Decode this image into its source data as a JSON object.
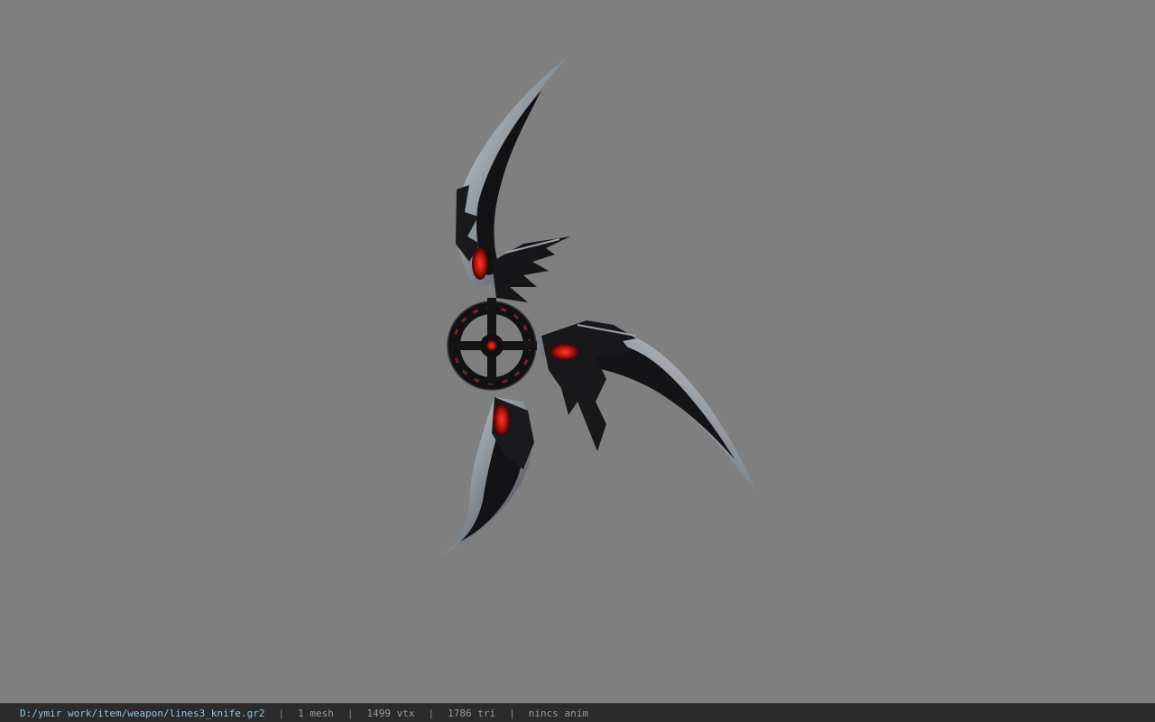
{
  "viewport": {
    "background": "#7f7f7f",
    "model_icon": "throwing-blade-model"
  },
  "status": {
    "path": "D:/ymir work/item/weapon/lines3_knife.gr2",
    "separator": "|",
    "mesh": "1 mesh",
    "vtx": "1499 vtx",
    "tri": "1786 tri",
    "anim": "nincs anim",
    "path_color": "#8fc4df"
  }
}
